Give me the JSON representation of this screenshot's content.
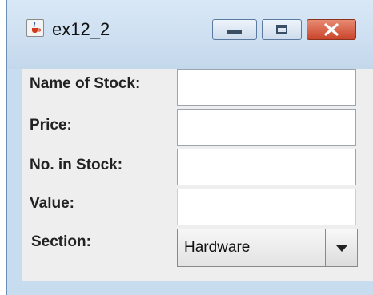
{
  "window": {
    "title": "ex12_2"
  },
  "form": {
    "name_label": "Name of Stock:",
    "price_label": "Price:",
    "number_label": "No. in Stock:",
    "value_label": "Value:",
    "section_label": "Section:",
    "name_value": "",
    "price_value": "",
    "number_value": "",
    "value_value": "",
    "section_selected": "Hardware"
  },
  "icons": {
    "app": "java-cup-icon",
    "minimize": "minimize-icon",
    "maximize": "maximize-icon",
    "close": "close-icon",
    "dropdown": "chevron-down-icon"
  }
}
